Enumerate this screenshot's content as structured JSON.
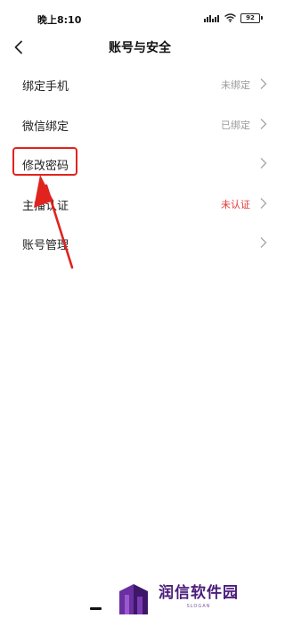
{
  "status_bar": {
    "time": "晚上8:10",
    "battery": "92"
  },
  "nav": {
    "title": "账号与安全"
  },
  "settings": [
    {
      "label": "绑定手机",
      "status": "未绑定",
      "alert": false
    },
    {
      "label": "微信绑定",
      "status": "已绑定",
      "alert": false
    },
    {
      "label": "修改密码",
      "status": "",
      "alert": false
    },
    {
      "label": "主播认证",
      "status": "未认证",
      "alert": true
    },
    {
      "label": "账号管理",
      "status": "",
      "alert": false
    }
  ],
  "watermark": {
    "title": "润信软件园",
    "slogan": "SLOGAN"
  },
  "colors": {
    "alert": "#e53935",
    "annotation": "#e0231f",
    "watermark": "#4a1d7a"
  }
}
